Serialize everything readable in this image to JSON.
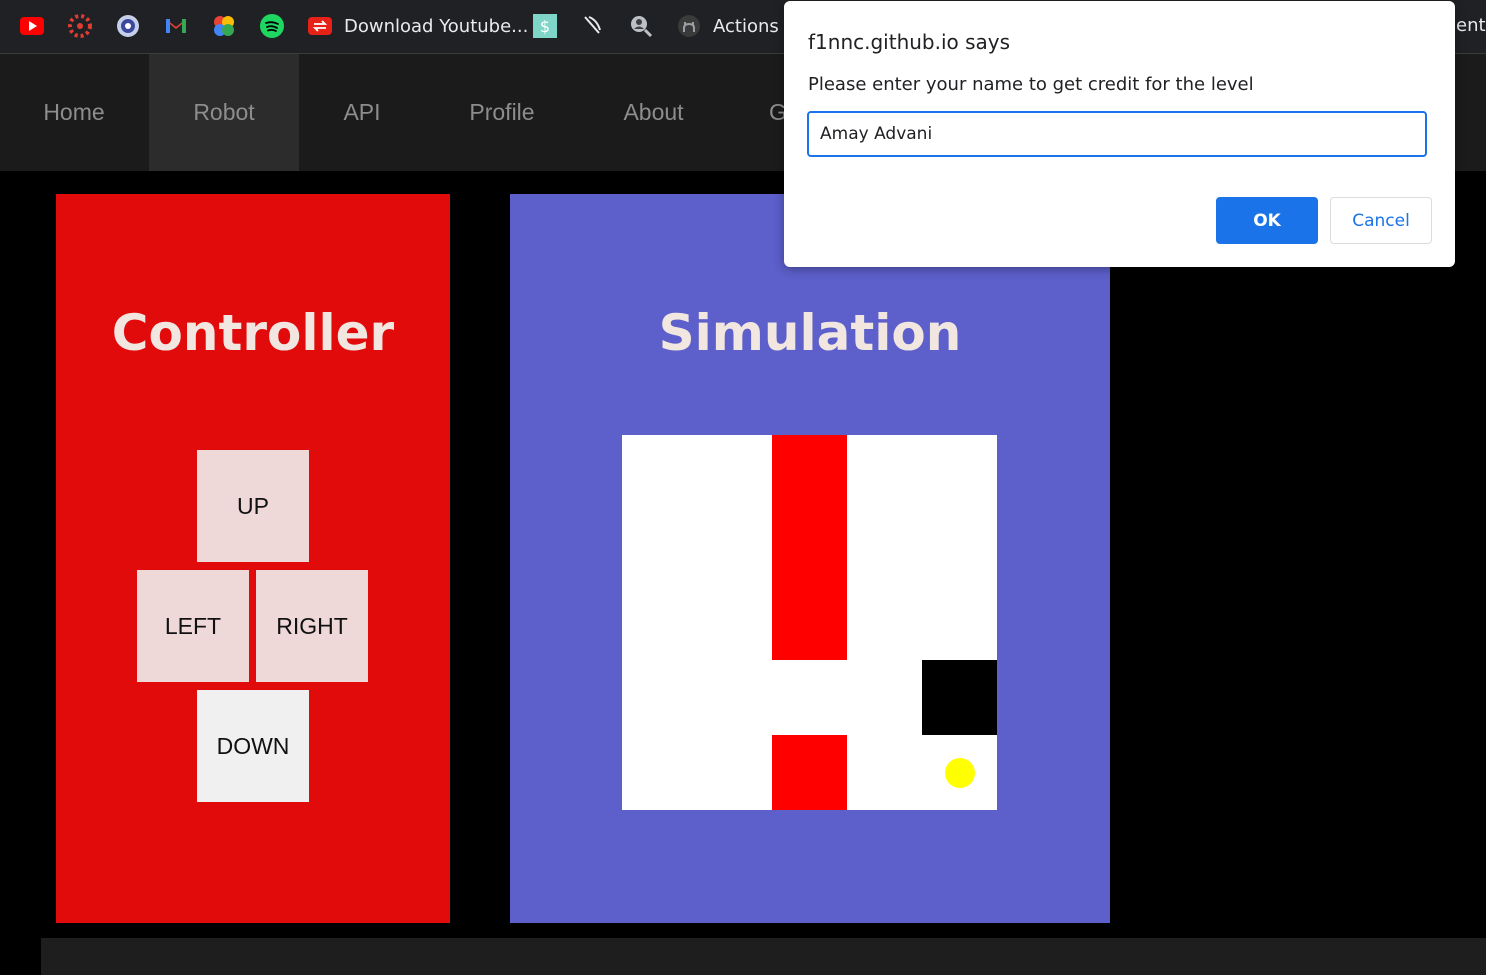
{
  "bookmarks": {
    "items": [
      {
        "icon": "youtube-icon"
      },
      {
        "icon": "canvas-icon"
      },
      {
        "icon": "shield-icon"
      },
      {
        "icon": "gmail-icon"
      },
      {
        "icon": "photos-icon"
      },
      {
        "icon": "spotify-icon"
      },
      {
        "icon": "youtube-download-icon",
        "label": "Download Youtube..."
      },
      {
        "icon": "dollar-icon"
      },
      {
        "icon": "feather-icon"
      },
      {
        "icon": "search-person-icon"
      },
      {
        "icon": "github-icon",
        "label": "Actions ·"
      }
    ],
    "right_cut_label": "ents"
  },
  "nav": {
    "items": [
      {
        "label": "Home"
      },
      {
        "label": "Robot",
        "active": true
      },
      {
        "label": "API"
      },
      {
        "label": "Profile"
      },
      {
        "label": "About"
      },
      {
        "label": "G"
      }
    ]
  },
  "controller": {
    "title": "Controller",
    "buttons": {
      "up": "UP",
      "left": "LEFT",
      "right": "RIGHT",
      "down": "DOWN"
    },
    "color": "#e10b0b"
  },
  "simulation": {
    "title": "Simulation",
    "color": "#5d5fca",
    "grid_size": 5,
    "cells": [
      {
        "col": 2,
        "row": 0,
        "kind": "wall",
        "color": "#ff0000"
      },
      {
        "col": 2,
        "row": 1,
        "kind": "wall",
        "color": "#ff0000"
      },
      {
        "col": 2,
        "row": 2,
        "kind": "wall",
        "color": "#ff0000"
      },
      {
        "col": 4,
        "row": 3,
        "kind": "block",
        "color": "#000000"
      },
      {
        "col": 2,
        "row": 4,
        "kind": "wall",
        "color": "#ff0000"
      },
      {
        "col": 4,
        "row": 4,
        "kind": "robot",
        "color": "#ffff00"
      }
    ]
  },
  "dialog": {
    "title": "f1nnc.github.io says",
    "message": "Please enter your name to get credit for the level",
    "input_value": "Amay Advani",
    "ok_label": "OK",
    "cancel_label": "Cancel",
    "accent": "#1a73e8"
  }
}
